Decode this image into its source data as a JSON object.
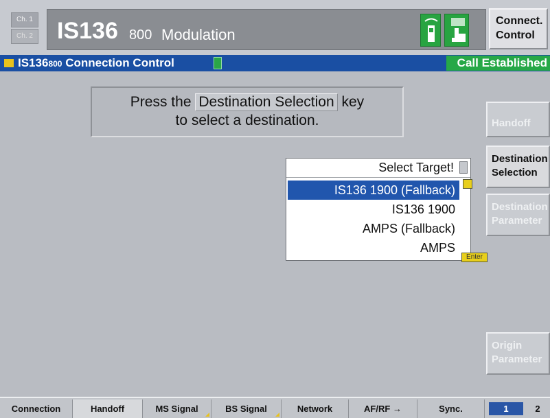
{
  "header": {
    "channel_1": "Ch. 1",
    "channel_2": "Ch. 2",
    "title_main": "IS136",
    "title_band": "800",
    "title_mode": "Modulation",
    "connect_control_line1": "Connect.",
    "connect_control_line2": "Control"
  },
  "status_bar": {
    "title": "IS136",
    "band": "800",
    "title_rest": "Connection Control",
    "call_status": "Call Established"
  },
  "instruction": {
    "line1_prefix": "Press the",
    "key_label": "Destination Selection",
    "line1_suffix": "key",
    "line2": "to select a destination."
  },
  "dropdown": {
    "header": "Select Target!",
    "items": [
      {
        "label": "IS136 1900 (Fallback)",
        "selected": true
      },
      {
        "label": "IS136 1900",
        "selected": false
      },
      {
        "label": "AMPS (Fallback)",
        "selected": false
      },
      {
        "label": "AMPS",
        "selected": false
      }
    ],
    "enter_label": "Enter"
  },
  "softkeys": {
    "handoff": "Handoff",
    "destination_selection_1": "Destination",
    "destination_selection_2": "Selection",
    "destination_parameter_1": "Destination",
    "destination_parameter_2": "Parameter",
    "origin_parameter_1": "Origin",
    "origin_parameter_2": "Parameter"
  },
  "tabs": [
    "Connection",
    "Handoff",
    "MS Signal",
    "BS Signal",
    "Network",
    "AF/RF",
    "Sync."
  ],
  "page_selector": {
    "page_1": "1",
    "page_2": "2"
  },
  "colors": {
    "status_bar": "#1a4fa3",
    "call_established": "#26a847",
    "selection": "#2156ad",
    "background": "#b9bcc2"
  }
}
